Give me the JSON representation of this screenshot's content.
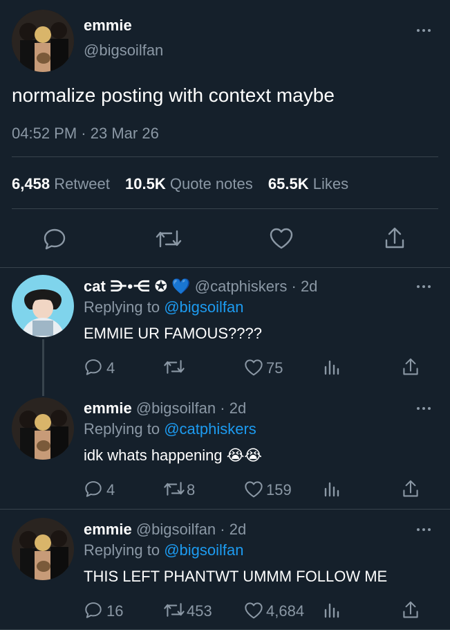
{
  "main_tweet": {
    "display_name": "emmie",
    "handle": "@bigsoilfan",
    "text": "normalize posting with context maybe",
    "time": "04:52 PM",
    "sep": "·",
    "date": "23 Mar 26",
    "stats": {
      "retweets_count": "6,458",
      "retweets_label": "Retweet",
      "quotes_count": "10.5K",
      "quotes_label": "Quote notes",
      "likes_count": "65.5K",
      "likes_label": "Likes"
    }
  },
  "replies": [
    {
      "display_name": "cat ⋺•⋲ ✪",
      "verified_heart": "💙",
      "handle": "@catphiskers",
      "time": "· 2d",
      "replying_prefix": "Replying to",
      "replying_to": "@bigsoilfan",
      "text": "EMMIE UR FAMOUS????",
      "reply_count": "4",
      "retweet_count": "",
      "like_count": "75"
    },
    {
      "display_name": "emmie",
      "handle": "@bigsoilfan",
      "time": "· 2d",
      "replying_prefix": "Replying to",
      "replying_to": "@catphiskers",
      "text": "idk whats happening",
      "emoji": "😭😭",
      "reply_count": "4",
      "retweet_count": "8",
      "like_count": "159"
    },
    {
      "display_name": "emmie",
      "handle": "@bigsoilfan",
      "time": "· 2d",
      "replying_prefix": "Replying to",
      "replying_to": "@bigsoilfan",
      "text": "THIS LEFT PHANTWT UMMM FOLLOW ME",
      "reply_count": "16",
      "retweet_count": "453",
      "like_count": "4,684"
    }
  ],
  "colors": {
    "background": "#15202b",
    "muted": "#8b98a5",
    "link": "#1d9bf0",
    "divider": "#38444d"
  },
  "icons": [
    "reply-icon",
    "retweet-icon",
    "like-icon",
    "share-icon",
    "analytics-icon",
    "more-icon"
  ]
}
